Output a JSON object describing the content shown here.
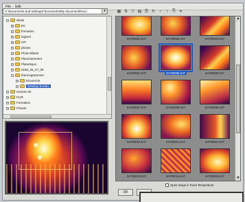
{
  "menu": {
    "items": [
      "File",
      "Edit"
    ]
  },
  "path": {
    "value": "C:\\Documents and Settings\\*documents\\My document\\Docu"
  },
  "tree": {
    "items": [
      {
        "label": "ahrds",
        "indent": 0,
        "expanded": true
      },
      {
        "label": "EC",
        "indent": 1
      },
      {
        "label": "formation",
        "indent": 1
      },
      {
        "label": "logiciel",
        "indent": 1
      },
      {
        "label": "IVF",
        "indent": 1
      },
      {
        "label": "photos",
        "indent": 1
      },
      {
        "label": "Photo Blaise",
        "indent": 1
      },
      {
        "label": "Planchamment",
        "indent": 1
      },
      {
        "label": "Plans/tujos",
        "indent": 1
      },
      {
        "label": "0168_25_07_05",
        "indent": 1
      },
      {
        "label": "thermogrammes",
        "indent": 1,
        "expanded": true
      },
      {
        "label": "EnvoiACE",
        "indent": 2
      },
      {
        "label": "Stasbay-bordes",
        "indent": 2,
        "selected": true
      },
      {
        "label": "exrar11-05",
        "indent": 0
      },
      {
        "label": "FLIR",
        "indent": 0
      },
      {
        "label": "Formation",
        "indent": 0
      },
      {
        "label": "Finacle",
        "indent": 0
      }
    ]
  },
  "toolbar": {
    "icons": [
      "thumbnail-view-icon",
      "sort-icon",
      "filter-icon",
      "grid-icon",
      "list-icon",
      "refresh-icon",
      "prev-icon",
      "next-icon",
      "copy-icon",
      "delete-icon"
    ],
    "glyphs": [
      "▦",
      "⇅",
      "▽",
      "▤",
      "☰",
      "↻",
      "‹",
      "›",
      "⎘",
      "✕"
    ]
  },
  "thumbnails": [
    {
      "label": "SAT00001.SAT",
      "style": "t1"
    },
    {
      "label": "SAT00002.SAT",
      "style": "t2"
    },
    {
      "label": "SAT00003.SAT",
      "style": "t3"
    },
    {
      "label": "SAT00004.SAT",
      "style": "t2"
    },
    {
      "label": "SAT00005.SAT",
      "style": "t4",
      "selected": true
    },
    {
      "label": "SAT00006.SAT",
      "style": "t3"
    },
    {
      "label": "SAT00007.SAT",
      "style": "t5"
    },
    {
      "label": "SAT00008.SAT",
      "style": "t6"
    },
    {
      "label": "SAT00009.SAT",
      "style": "t12"
    },
    {
      "label": "SAT00010.SAT",
      "style": "t10"
    },
    {
      "label": "SAT00011.SAT",
      "style": "t8"
    },
    {
      "label": "SAT00012.SAT",
      "style": "t9"
    },
    {
      "label": "SAT00013.SAT",
      "style": "t11"
    },
    {
      "label": "SAT00014.SAT",
      "style": "t7"
    },
    {
      "label": "SAT00015.SAT",
      "style": "t1"
    }
  ],
  "checkbox": {
    "label": "Open Image in Fixed Temperature",
    "checked": false
  },
  "ok_button": {
    "label": "OK"
  }
}
